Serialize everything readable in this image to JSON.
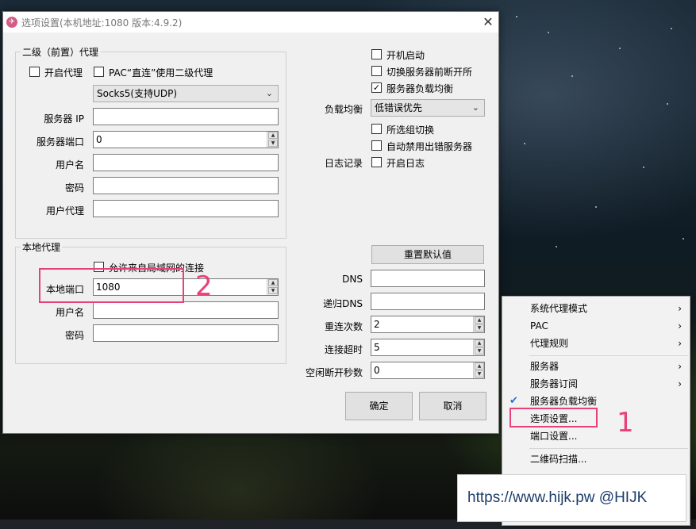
{
  "window": {
    "title": "选项设置(本机地址:1080 版本:4.9.2)",
    "icon": "app-icon",
    "close_glyph": "✕"
  },
  "secondary_proxy": {
    "group_title": "二级（前置）代理",
    "enable_label": "开启代理",
    "enable_checked": false,
    "pac_label": "PAC“直连”使用二级代理",
    "pac_checked": false,
    "proxy_type": "Socks5(支持UDP)",
    "server_ip_label": "服务器 IP",
    "server_ip_value": "",
    "server_port_label": "服务器端口",
    "server_port_value": "0",
    "username_label": "用户名",
    "username_value": "",
    "password_label": "密码",
    "password_value": "",
    "user_agent_label": "用户代理",
    "user_agent_value": ""
  },
  "local_proxy": {
    "group_title": "本地代理",
    "allow_lan_label": "允许来自局域网的连接",
    "allow_lan_checked": false,
    "port_label": "本地端口",
    "port_value": "1080",
    "username_label": "用户名",
    "username_value": "",
    "password_label": "密码",
    "password_value": ""
  },
  "options": {
    "autostart_label": "开机启动",
    "autostart_checked": false,
    "disconnect_label": "切换服务器前断开所",
    "disconnect_checked": false,
    "balance_label": "服务器负载均衡",
    "balance_checked": true,
    "balance_mode_label": "负载均衡",
    "balance_mode_value": "低错误优先",
    "same_group_label": "所选组切换",
    "same_group_checked": false,
    "auto_ban_label": "自动禁用出错服务器",
    "auto_ban_checked": false,
    "log_label": "日志记录",
    "open_log_label": "开启日志",
    "open_log_checked": false
  },
  "network": {
    "reset_label": "重置默认值",
    "dns_label": "DNS",
    "dns_value": "",
    "recursive_dns_label": "递归DNS",
    "recursive_dns_value": "",
    "reconnect_label": "重连次数",
    "reconnect_value": "2",
    "timeout_label": "连接超时",
    "timeout_value": "5",
    "idle_label": "空闲断开秒数",
    "idle_value": "0"
  },
  "buttons": {
    "ok": "确定",
    "cancel": "取消"
  },
  "annotations": {
    "marker_1": "1",
    "marker_2": "2",
    "highlight_color": "#e8417a"
  },
  "context_menu": {
    "items": [
      {
        "label": "系统代理模式",
        "submenu": true
      },
      {
        "label": "PAC",
        "submenu": true
      },
      {
        "label": "代理规则",
        "submenu": true
      },
      {
        "label": "服务器",
        "submenu": true
      },
      {
        "label": "服务器订阅",
        "submenu": true
      },
      {
        "label": "服务器负载均衡",
        "checked": true
      },
      {
        "label": "选项设置..."
      },
      {
        "label": "端口设置..."
      },
      {
        "label": "二维码扫描..."
      }
    ],
    "check_glyph": "✔",
    "arrow_glyph": "›"
  },
  "watermark": {
    "text": "https://www.hijk.pw @HIJK"
  }
}
